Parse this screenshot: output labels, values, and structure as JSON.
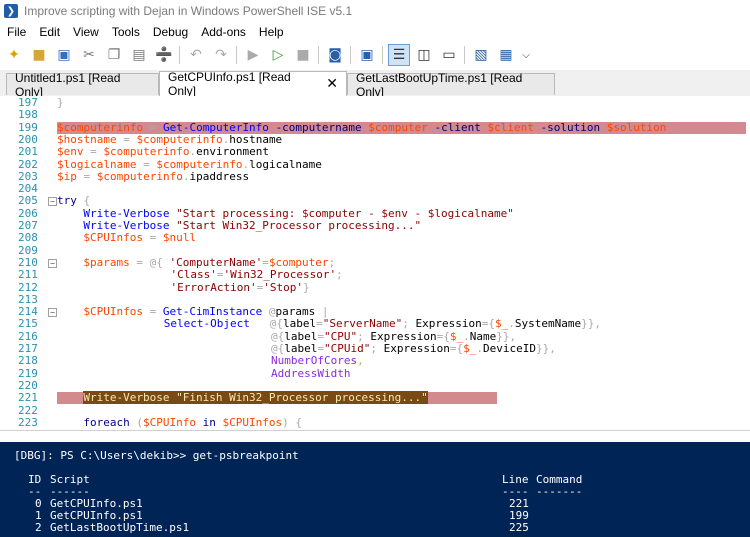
{
  "window": {
    "title": "Improve scripting with Dejan in Windows PowerShell ISE v5.1",
    "icon": "powershell-icon"
  },
  "menu": [
    "File",
    "Edit",
    "View",
    "Tools",
    "Debug",
    "Add-ons",
    "Help"
  ],
  "tabs": [
    {
      "label": "Untitled1.ps1 [Read Only]",
      "active": false
    },
    {
      "label": "GetCPUInfo.ps1 [Read Only]",
      "active": true,
      "close": "✕"
    },
    {
      "label": "GetLastBootUpTime.ps1 [Read Only]",
      "active": false
    }
  ],
  "editor": {
    "lines": [
      {
        "n": "197",
        "text": "        }"
      },
      {
        "n": "198",
        "text": ""
      },
      {
        "n": "199",
        "text": "        $computerinfo = Get-ComputerInfo -computername $computer -client $client -solution $solution"
      },
      {
        "n": "200",
        "text": "        $hostname = $computerinfo.hostname"
      },
      {
        "n": "201",
        "text": "        $env = $computerinfo.environment"
      },
      {
        "n": "202",
        "text": "        $logicalname = $computerinfo.logicalname"
      },
      {
        "n": "203",
        "text": "        $ip = $computerinfo.ipaddress"
      },
      {
        "n": "204",
        "text": ""
      },
      {
        "n": "205",
        "text": "        try {"
      },
      {
        "n": "206",
        "text": "            Write-Verbose \"Start processing: $computer - $env - $logicalname\""
      },
      {
        "n": "207",
        "text": "            Write-Verbose \"Start Win32_Processor processing...\""
      },
      {
        "n": "208",
        "text": "            $CPUInfos = $null"
      },
      {
        "n": "209",
        "text": ""
      },
      {
        "n": "210",
        "text": "            $params = @{ 'ComputerName'=$computer;"
      },
      {
        "n": "211",
        "text": "                         'Class'='Win32_Processor';"
      },
      {
        "n": "212",
        "text": "                         'ErrorAction'='Stop'}"
      },
      {
        "n": "213",
        "text": ""
      },
      {
        "n": "214",
        "text": "            $CPUInfos = Get-CimInstance @params |"
      },
      {
        "n": "215",
        "text": "                        Select-Object   @{label=\"ServerName\"; Expression={$_.SystemName}},"
      },
      {
        "n": "216",
        "text": "                                        @{label=\"CPU\"; Expression={$_.Name}},"
      },
      {
        "n": "217",
        "text": "                                        @{label=\"CPUid\"; Expression={$_.DeviceID}},"
      },
      {
        "n": "218",
        "text": "                                        NumberOfCores,"
      },
      {
        "n": "219",
        "text": "                                        AddressWidth"
      },
      {
        "n": "220",
        "text": ""
      },
      {
        "n": "221",
        "text": "            Write-Verbose \"Finish Win32_Processor processing...\""
      },
      {
        "n": "222",
        "text": ""
      },
      {
        "n": "223",
        "text": "            foreach ($CPUInfo in $CPUInfos) {"
      }
    ]
  },
  "console": {
    "prompt": "[DBG]: PS C:\\Users\\dekib>> get-psbreakpoint",
    "headers": {
      "id": "ID",
      "script": "Script",
      "line": "Line",
      "command": "Command"
    },
    "rules": {
      "id": "--",
      "script": "------",
      "line": "----",
      "command": "-------"
    },
    "rows": [
      {
        "id": "0",
        "script": "GetCPUInfo.ps1",
        "line": "221"
      },
      {
        "id": "1",
        "script": "GetCPUInfo.ps1",
        "line": "199"
      },
      {
        "id": "2",
        "script": "GetLastBootUpTime.ps1",
        "line": "225"
      }
    ]
  },
  "colors": {
    "breakpoint": "#d38a8f",
    "current_line": "#7a4a14",
    "console_bg": "#012456"
  }
}
